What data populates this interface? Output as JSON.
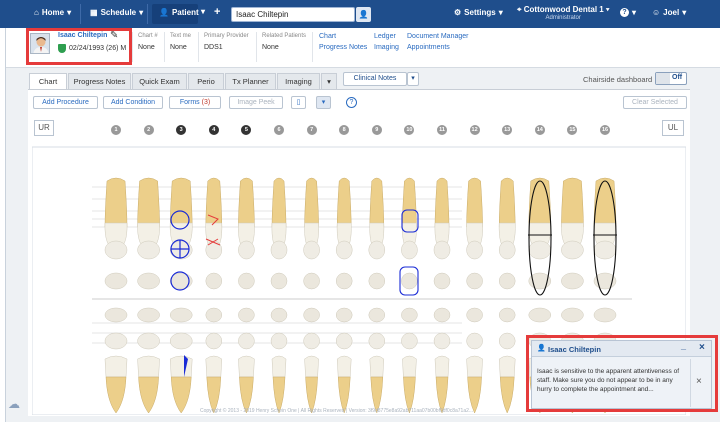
{
  "nav": {
    "home": "Home",
    "schedule": "Schedule",
    "patient": "Patient",
    "plus": "+",
    "search_value": "Isaac Chiltepin",
    "settings": "Settings",
    "location": "Cottonwood Dental 1",
    "role": "Administrator",
    "help": "?",
    "user": "Joel",
    "brand_color": "#1f4e8c"
  },
  "patient": {
    "name": "Isaac Chiltepin",
    "dob_age_sex": "02/24/1993 (26) M",
    "fields": [
      {
        "label": "Chart #",
        "value": "None"
      },
      {
        "label": "Text me",
        "value": "None"
      },
      {
        "label": "Primary Provider",
        "value": "DDS1"
      },
      {
        "label": "Related Patients",
        "value": "None"
      }
    ],
    "links": [
      "Chart",
      "Ledger",
      "Document Manager",
      "Progress Notes",
      "Imaging",
      "Appointments"
    ]
  },
  "tabs": [
    "Chart",
    "Progress Notes",
    "Quick Exam",
    "Perio",
    "Tx Planner",
    "Imaging"
  ],
  "clinical_notes": "Clinical Notes",
  "chairside": {
    "label": "Chairside dashboard",
    "state": "Off"
  },
  "toolbar": {
    "add_procedure": "Add Procedure",
    "add_condition": "Add Condition",
    "forms": "Forms",
    "forms_count": "(3)",
    "image_peek": "Image Peek",
    "clear_selected": "Clear Selected",
    "help": "?"
  },
  "quadrants": {
    "left": "UR",
    "right": "UL"
  },
  "tooth_numbers": [
    "1",
    "2",
    "3",
    "4",
    "5",
    "6",
    "7",
    "8",
    "9",
    "10",
    "11",
    "12",
    "13",
    "14",
    "15",
    "16"
  ],
  "alert": {
    "title": "Isaac Chiltepin",
    "message": "Isaac is sensitive to the apparent attentiveness of staff. Make sure you do not appear to be in any hurry to complete the appointment and...",
    "minimize": "_",
    "close": "×",
    "dismiss": "×"
  },
  "copyright": "Copyright © 2013 - 2019 Henry Schein One | All Rights Reserved | Version: 3f9d8775e8a92ab711aa07b00bf0df0c8a71a2..."
}
